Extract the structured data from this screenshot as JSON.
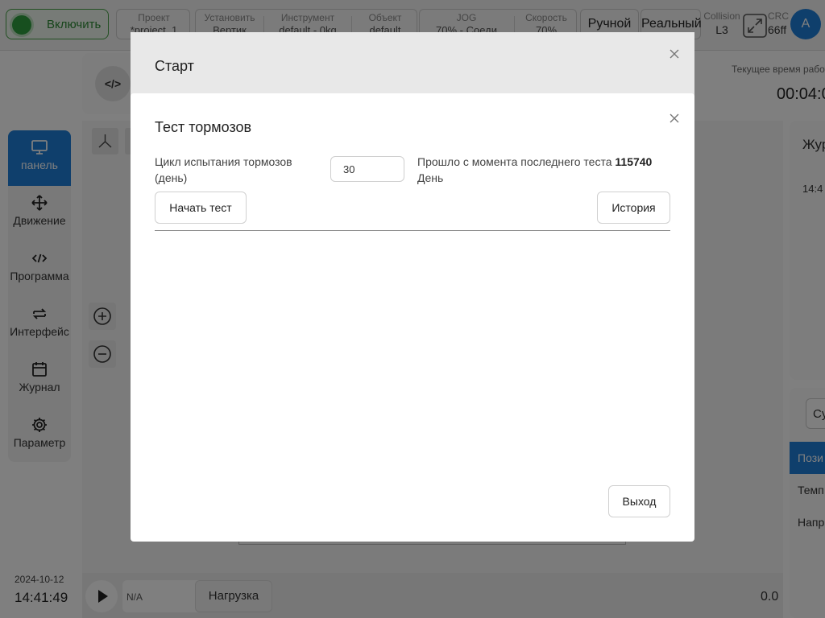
{
  "topbar": {
    "enable_label": "Включить",
    "project": {
      "caption": "Проект",
      "value": "*project_1"
    },
    "install": {
      "caption": "Установить",
      "value": "Вертик"
    },
    "tool": {
      "caption": "Инструмент",
      "value": "default - 0kg"
    },
    "object": {
      "caption": "Объект",
      "value": "default"
    },
    "jog": {
      "caption": "JOG",
      "value": "70% - Соеди"
    },
    "speed": {
      "caption": "Скорость",
      "value": "70%"
    },
    "manual_label": "Ручной",
    "real_label": "Реальный",
    "collision": {
      "caption": "Collision",
      "value": "L3"
    },
    "crc": {
      "caption": "CRC",
      "value": "66ff"
    },
    "avatar_letter": "A"
  },
  "sidebar": {
    "items": [
      {
        "label": "панель",
        "icon": "monitor-icon"
      },
      {
        "label": "Движение",
        "icon": "move-icon"
      },
      {
        "label": "Программа",
        "icon": "code-icon"
      },
      {
        "label": "Интерфейс",
        "icon": "swap-icon"
      },
      {
        "label": "Журнал",
        "icon": "calendar-icon"
      },
      {
        "label": "Параметр",
        "icon": "gear-icon"
      }
    ]
  },
  "background": {
    "code_label": "</>",
    "runtime_label": "Текущее время работы",
    "runtime_value": "00:04:0",
    "right_title": "Жур",
    "right_time": "14:4",
    "chip_label": "Су",
    "position_label": "Пози",
    "temp_label": "Темп",
    "voltage_label": "Напр",
    "date": "2024-10-12",
    "time": "14:41:49",
    "status_na": "N/A",
    "load_label": "Нагрузка",
    "speed_value": "0.0"
  },
  "start_dialog": {
    "title": "Старт"
  },
  "brake_dialog": {
    "title": "Тест тормозов",
    "cycle_label": "Цикл испытания тормозов (день)",
    "cycle_value": "30",
    "elapsed_prefix": "Прошло с момента последнего теста",
    "elapsed_value": "115740",
    "elapsed_unit": "День",
    "start_test_label": "Начать тест",
    "history_label": "История",
    "exit_label": "Выход"
  },
  "colors": {
    "accent": "#1e7ed8",
    "enable_green": "#2e9e3f"
  }
}
